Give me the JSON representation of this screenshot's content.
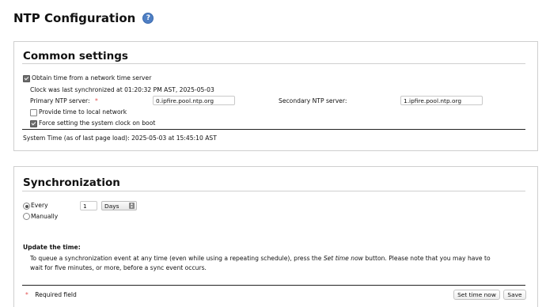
{
  "page": {
    "title": "NTP Configuration",
    "help_icon": "help-icon"
  },
  "common": {
    "heading": "Common settings",
    "obtain_time_label": "Obtain time from a network time server",
    "obtain_time_checked": true,
    "last_sync_text": "Clock was last synchronized at 01:20:32 PM AST, 2025-05-03",
    "primary_label": "Primary NTP server:",
    "primary_required_mark": "*",
    "primary_value": "0.ipfire.pool.ntp.org",
    "secondary_label": "Secondary NTP server:",
    "secondary_value": "1.ipfire.pool.ntp.org",
    "provide_time_label": "Provide time to local network",
    "provide_time_checked": false,
    "force_clock_label": "Force setting the system clock on boot",
    "force_clock_checked": true,
    "system_time_text": "System Time (as of last page load): 2025-05-03 at 15:45:10 AST"
  },
  "sync": {
    "heading": "Synchronization",
    "every_label": "Every",
    "every_selected": true,
    "interval_value": "1",
    "unit_value": "Days",
    "manually_label": "Manually",
    "update_heading": "Update the time:",
    "desc_part1": "To queue a synchronization event at any time (even while using a repeating schedule), press the ",
    "desc_button_name": "Set time now",
    "desc_part2": " button. Please note that you may have to",
    "desc_line2": "wait for five minutes, or more, before a sync event occurs.",
    "required_mark": "*",
    "required_label": "Required field",
    "set_time_button": "Set time now",
    "save_button": "Save"
  },
  "colors": {
    "required": "#e04a4a",
    "help": "#4f7fc4",
    "border": "#cfcfcf"
  }
}
